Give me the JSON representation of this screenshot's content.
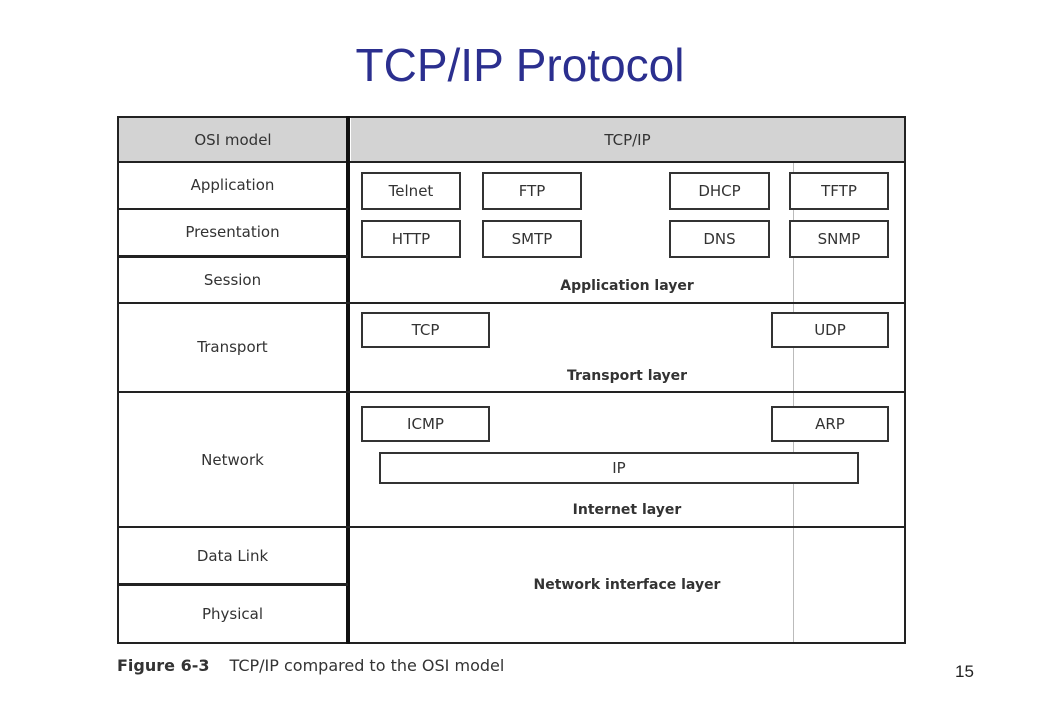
{
  "slide": {
    "title": "TCP/IP Protocol",
    "page_number": "15"
  },
  "diagram": {
    "headers": {
      "osi": "OSI model",
      "tcpip": "TCP/IP"
    },
    "osi_layers": [
      "Application",
      "Presentation",
      "Session",
      "Transport",
      "Network",
      "Data Link",
      "Physical"
    ],
    "tcpip_layers": {
      "application": {
        "label": "Application layer",
        "protocols": [
          "Telnet",
          "FTP",
          "DHCP",
          "TFTP",
          "HTTP",
          "SMTP",
          "DNS",
          "SNMP"
        ]
      },
      "transport": {
        "label": "Transport layer",
        "protocols": [
          "TCP",
          "UDP"
        ]
      },
      "internet": {
        "label": "Internet layer",
        "protocols": [
          "ICMP",
          "ARP",
          "IP"
        ]
      },
      "network_interface": {
        "label": "Network interface layer"
      }
    },
    "caption": {
      "figure": "Figure 6-3",
      "text": "TCP/IP compared to the OSI model"
    }
  }
}
